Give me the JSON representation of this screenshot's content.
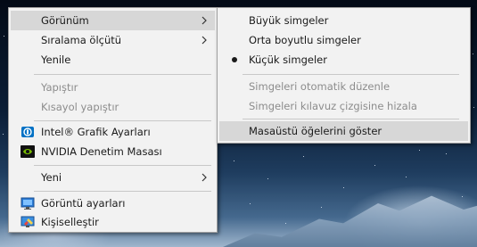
{
  "main_menu": {
    "view_label": "Görünüm",
    "sort_label": "Sıralama ölçütü",
    "refresh_label": "Yenile",
    "paste_label": "Yapıştır",
    "paste_shortcut_label": "Kısayol yapıştır",
    "intel_label": "Intel® Grafik Ayarları",
    "nvidia_label": "NVIDIA Denetim Masası",
    "new_label": "Yeni",
    "display_settings_label": "Görüntü ayarları",
    "personalize_label": "Kişiselleştir"
  },
  "view_submenu": {
    "large_icons_label": "Büyük simgeler",
    "medium_icons_label": "Orta boyutlu simgeler",
    "small_icons_label": "Küçük simgeler",
    "auto_arrange_label": "Simgeleri otomatik düzenle",
    "align_grid_label": "Simgeleri kılavuz çizgisine hizala",
    "show_desktop_icons_label": "Masaüstü öğelerini göster",
    "selected_size": "small"
  },
  "icons": {
    "intel": "intel-graphics-icon",
    "nvidia": "nvidia-icon",
    "display": "display-settings-icon",
    "personalize": "personalize-icon"
  },
  "colors": {
    "menu_bg": "#f2f2f2",
    "highlight": "#d7d7d7",
    "disabled_text": "#8c8c8c",
    "nvidia_green": "#76b900",
    "intel_blue": "#0071c5"
  }
}
